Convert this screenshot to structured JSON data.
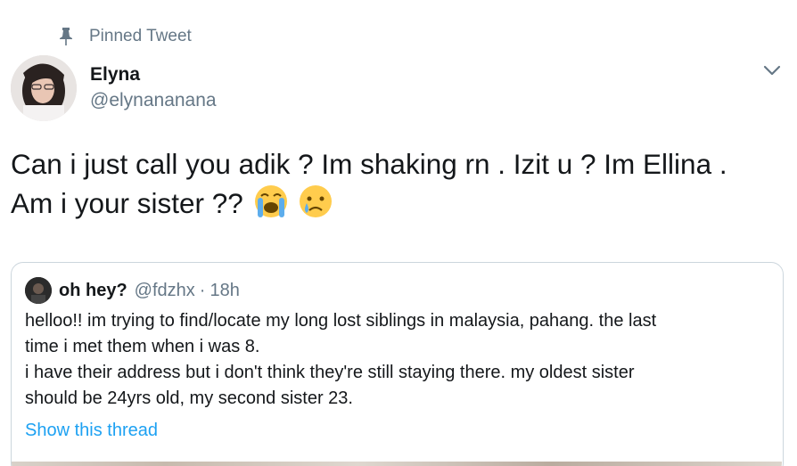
{
  "pinned": {
    "label": "Pinned Tweet",
    "icon": "pin-icon"
  },
  "author": {
    "name": "Elyna",
    "handle": "@elynananana",
    "avatar_icon": "avatar-photo"
  },
  "menu": {
    "icon": "chevron-down-icon"
  },
  "tweet": {
    "line1": "Can i just call you adik ? Im shaking rn . Izit u ? Im Ellina .",
    "line2": "Am i your sister ??",
    "emojis": [
      "loudly-crying-face",
      "crying-face"
    ]
  },
  "quote": {
    "name": "oh hey?",
    "handle": "@fdzhx",
    "separator": "·",
    "time": "18h",
    "lines": [
      "helloo!! im trying to find/locate my long lost siblings in malaysia, pahang. the last",
      "time i met them when i was 8.",
      "i have their address but i don't think they're still staying there. my oldest sister",
      "should be 24yrs old, my second sister 23."
    ],
    "show_thread": "Show this thread"
  },
  "colors": {
    "text_primary": "#14171a",
    "text_secondary": "#657786",
    "link": "#1da1f2",
    "border": "#ccd6dd"
  }
}
